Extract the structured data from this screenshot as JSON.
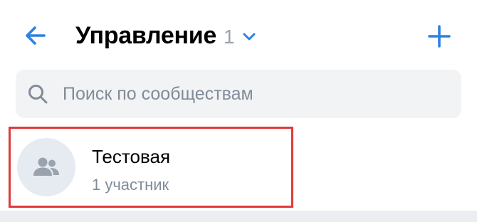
{
  "header": {
    "title": "Управление",
    "count": "1",
    "icons": {
      "back": "arrow-left-icon",
      "dropdown": "chevron-down-icon",
      "add": "plus-icon"
    }
  },
  "search": {
    "placeholder": "Поиск по сообществам",
    "value": "",
    "icon": "search-icon"
  },
  "communities": [
    {
      "name": "Тестовая",
      "members": "1 участник",
      "avatar_icon": "users-icon",
      "highlighted": true
    }
  ],
  "colors": {
    "accent": "#2d81e0",
    "highlight_border": "#e03a3a",
    "secondary_text": "#818c99",
    "search_bg": "#f2f3f5",
    "avatar_bg": "#e6ebf2"
  }
}
